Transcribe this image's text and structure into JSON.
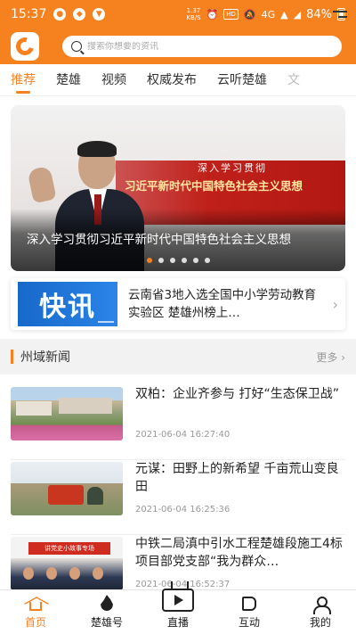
{
  "status_bar": {
    "time": "15:37",
    "speed_value": "1.37",
    "speed_unit": "KB/S",
    "hd_label": "HD",
    "network": "4G",
    "battery": "84%"
  },
  "header": {
    "search_placeholder": "搜索你想要的资讯"
  },
  "tabs": [
    {
      "label": "推荐",
      "active": true
    },
    {
      "label": "楚雄",
      "active": false
    },
    {
      "label": "视频",
      "active": false
    },
    {
      "label": "权威发布",
      "active": false
    },
    {
      "label": "云听楚雄",
      "active": false
    },
    {
      "label": "文",
      "active": false
    }
  ],
  "banner": {
    "image_subtitle": "深入学习贯彻",
    "image_title": "习近平新时代中国特色社会主义思想",
    "caption": "深入学习贯彻习近平新时代中国特色社会主义思想",
    "dot_count": 6,
    "active_dot": 0
  },
  "flash": {
    "badge": "快讯",
    "text": "云南省3地入选全国中小学劳动教育实验区  楚雄州榜上…"
  },
  "section": {
    "title": "州域新闻",
    "more": "更多"
  },
  "news": [
    {
      "title": "双柏：企业齐参与 打好“生态保卫战”",
      "time": "2021-06-04 16:27:40"
    },
    {
      "title": "元谋：田野上的新希望 千亩荒山变良田",
      "time": "2021-06-04 16:25:36"
    },
    {
      "title": "中铁二局滇中引水工程楚雄段施工4标项目部党支部“我为群众…",
      "time": "2021-06-04 16:52:37",
      "thumb_banner": "讲党史小故事专场"
    }
  ],
  "bottom_nav": [
    {
      "label": "首页",
      "icon": "home-icon",
      "active": true
    },
    {
      "label": "楚雄号",
      "icon": "flame-icon",
      "active": false
    },
    {
      "label": "直播",
      "icon": "live-tv-icon",
      "active": false
    },
    {
      "label": "互动",
      "icon": "speaker-icon",
      "active": false
    },
    {
      "label": "我的",
      "icon": "user-icon",
      "active": false
    }
  ],
  "colors": {
    "brand": "#f5821f",
    "flash_blue": "#1769c9"
  }
}
